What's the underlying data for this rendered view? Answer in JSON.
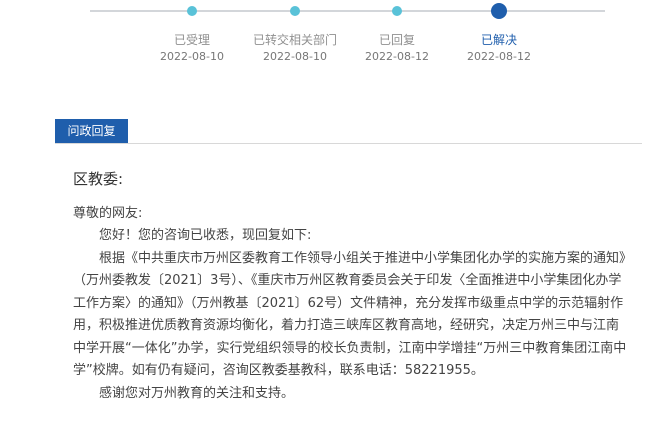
{
  "progress": {
    "steps": [
      {
        "label": "已受理",
        "date": "2022-08-10"
      },
      {
        "label": "已转交相关部门",
        "date": "2022-08-10"
      },
      {
        "label": "已回复",
        "date": "2022-08-12"
      },
      {
        "label": "已解决",
        "date": "2022-08-12"
      }
    ],
    "colors": {
      "done": "#59c2d8",
      "current": "#1f5eac",
      "track": "#d3d6da"
    }
  },
  "tab": {
    "label": "问政回复",
    "color": "#1f5eac"
  },
  "reply": {
    "addressee": "区教委:",
    "greeting": "尊敬的网友:",
    "p1": "您好！您的咨询已收悉，现回复如下:",
    "p2": "根据《中共重庆市万州区委教育工作领导小组关于推进中小学集团化办学的实施方案的通知》（万州委教发〔2021〕3号）、《重庆市万州区教育委员会关于印发〈全面推进中小学集团化办学工作方案〉的通知》（万州教基〔2021〕62号）文件精神，充分发挥市级重点中学的示范辐射作用，积极推进优质教育资源均衡化，着力打造三峡库区教育高地，经研究，决定万州三中与江南中学开展“一体化”办学，实行党组织领导的校长负责制，江南中学增挂“万州三中教育集团江南中学”校牌。如有仍有疑问，咨询区教委基教科，联系电话：58221955。",
    "p3": "感谢您对万州教育的关注和支持。"
  }
}
